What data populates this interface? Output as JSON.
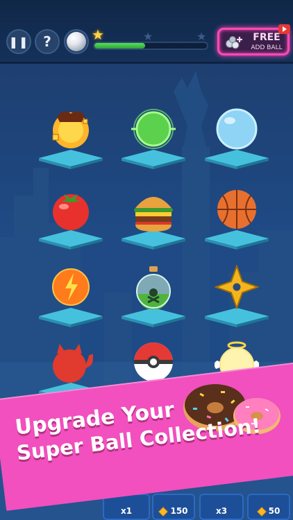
{
  "topbar": {
    "pause_icon": "pause-icon",
    "help_label": "?",
    "ball_icon": "pearl-ball-icon",
    "progress": 0.45,
    "stars_earned": 1,
    "stars_total": 3,
    "free_button": {
      "title": "FREE",
      "subtitle": "ADD BALL",
      "icon": "add-ball-icon",
      "badge_icon": "video-play-icon",
      "accent": "#ff49b7"
    }
  },
  "ball_grid": [
    {
      "name": "fire-ball"
    },
    {
      "name": "green-orb-ball"
    },
    {
      "name": "bubble-ball"
    },
    {
      "name": "tomato-ball"
    },
    {
      "name": "burger-ball"
    },
    {
      "name": "basketball-ball"
    },
    {
      "name": "lightning-ball"
    },
    {
      "name": "poison-flask-ball"
    },
    {
      "name": "shuriken-ball"
    },
    {
      "name": "devil-ball"
    },
    {
      "name": "pokeball-ball"
    },
    {
      "name": "angel-ball"
    }
  ],
  "banner": {
    "line1": "Upgrade Your",
    "line2": "Super Ball Collection!",
    "color": "#f24fbf"
  },
  "shop": [
    {
      "label": "x1"
    },
    {
      "label": "150",
      "icon": "gem-icon"
    },
    {
      "label": "x3"
    },
    {
      "label": "50",
      "icon": "gem-icon"
    }
  ]
}
